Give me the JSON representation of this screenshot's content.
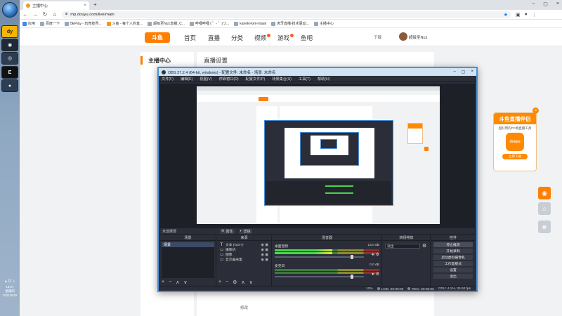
{
  "taskbar": {
    "tray_time": "18:07",
    "tray_day": "星期四",
    "tray_date": "2021/8/19"
  },
  "browser": {
    "tab_title": "主播中心",
    "url": "mp.douyu.com/live/main",
    "bookmarks": [
      {
        "label": "应用"
      },
      {
        "label": "百度一下"
      },
      {
        "label": "5EPlay - 玩竞技界..."
      },
      {
        "label": "斗鱼 - 每个人的直..."
      },
      {
        "label": "超级至Nu1直播_C..."
      },
      {
        "label": "哔哩哔哩 ( ゜- ゜)つ..."
      },
      {
        "label": "kaneki-ken-mask"
      },
      {
        "label": "虎牙直播-技术驱动..."
      },
      {
        "label": "主播中心"
      }
    ]
  },
  "douyu": {
    "logo": "斗鱼",
    "nav": [
      "首页",
      "直播",
      "分类",
      "视频",
      "游戏",
      "鱼吧"
    ],
    "download": "下载",
    "user": "超级至Nu1",
    "sidebar_title": "主播中心",
    "content_title": "直播设置",
    "edit_link": "修改",
    "ad": {
      "title": "斗鱼直播伴侣",
      "desc": "超好用的PC端直播工具",
      "logo": "douyu",
      "button": "立即下载"
    }
  },
  "obs": {
    "title": "OBS 27.2.4 (64-bit, windows) - 配置文件: 未命名 - 场景: 未命名",
    "menu": [
      "文件(F)",
      "编辑(E)",
      "视图(V)",
      "停靠窗口(D)",
      "配置文件(P)",
      "场景集合(S)",
      "工具(T)",
      "帮助(H)"
    ],
    "no_source_selected": "未选择源",
    "properties_label": "属性",
    "filters_label": "滤镜",
    "docks": {
      "scenes": "场景",
      "sources": "来源",
      "mixer": "混音器",
      "transitions": "转场特效",
      "controls": "控件"
    },
    "scenes": [
      "场景"
    ],
    "sources": [
      {
        "icon": "text-icon",
        "glyph": "T",
        "label": "文本 (GDI+)"
      },
      {
        "icon": "camera-icon",
        "glyph": "▭",
        "label": "摄像机"
      },
      {
        "icon": "image-icon",
        "glyph": "▭",
        "label": "图像"
      },
      {
        "icon": "monitor-icon",
        "glyph": "▭",
        "label": "显示器采集"
      }
    ],
    "mixer": [
      {
        "name": "桌面音频",
        "db": "13.0 dB",
        "level": 0.55,
        "fader": 0.85
      },
      {
        "name": "麦克风",
        "db": "0.0 dB",
        "level": 0.0,
        "fader": 0.85
      }
    ],
    "transition_select": "淡出",
    "controls": [
      "停止推流",
      "开始录制",
      "启动虚拟摄像机",
      "工作室模式",
      "设置",
      "退出"
    ],
    "status": {
      "live_label": "LIVE:",
      "live_time": "00:00:00",
      "rec_label": "REC:",
      "rec_time": "00:00:00",
      "cpu": "CPU: 4.1%, 30.00 fps",
      "dropped": "12%"
    }
  },
  "colors": {
    "douyu_orange": "#ff7f00",
    "obs_bg": "#2b2e38",
    "obs_border": "#4a90d9",
    "meter_green": "#49d34e"
  }
}
